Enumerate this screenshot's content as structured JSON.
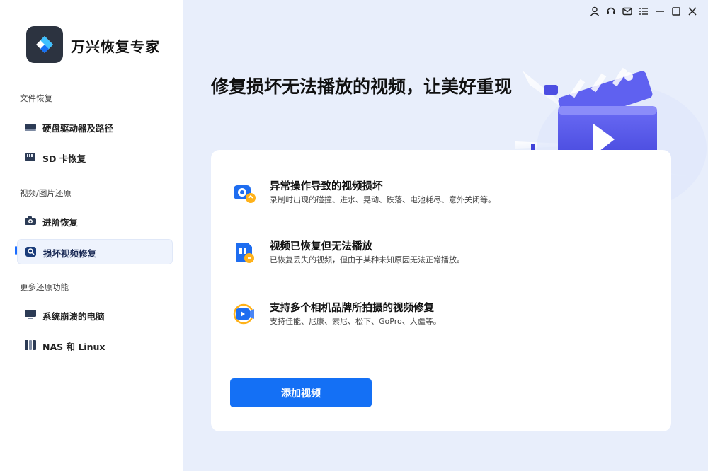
{
  "app": {
    "title": "万兴恢复专家"
  },
  "window": {
    "controls": [
      "account-icon",
      "support-icon",
      "mail-icon",
      "menu-icon",
      "minimize-icon",
      "maximize-icon",
      "close-icon"
    ]
  },
  "sidebar": {
    "sections": [
      {
        "title": "文件恢复",
        "items": [
          {
            "label": "硬盘驱动器及路径",
            "icon": "hard-drive-icon"
          },
          {
            "label": "SD 卡恢复",
            "icon": "sd-card-icon"
          }
        ]
      },
      {
        "title": "视频/图片还原",
        "items": [
          {
            "label": "进阶恢复",
            "icon": "camera-icon"
          },
          {
            "label": "损坏视频修复",
            "icon": "video-repair-icon",
            "active": true
          }
        ]
      },
      {
        "title": "更多还原功能",
        "items": [
          {
            "label": "系统崩溃的电脑",
            "icon": "monitor-icon"
          },
          {
            "label": "NAS 和 Linux",
            "icon": "nas-icon"
          }
        ]
      }
    ]
  },
  "main": {
    "headline": "修复损坏无法播放的视频，让美好重现",
    "features": [
      {
        "title": "异常操作导致的视频损坏",
        "desc": "录制时出现的碰撞、进水、晃动、跌落、电池耗尽、意外关闭等。",
        "icon": "camera-damage-icon"
      },
      {
        "title": "视频已恢复但无法播放",
        "desc": "已恢复丢失的视频，但由于某种未知原因无法正常播放。",
        "icon": "video-file-icon"
      },
      {
        "title": "支持多个相机品牌所拍摄的视频修复",
        "desc": "支持佳能、尼康、索尼、松下、GoPro、大疆等。",
        "icon": "video-camera-icon"
      }
    ],
    "add_button": "添加视频"
  },
  "colors": {
    "accent": "#1470f5",
    "main_bg": "#e8eefb",
    "sidebar_bg": "#ffffff",
    "hero_purple": "#5b5cf0"
  }
}
